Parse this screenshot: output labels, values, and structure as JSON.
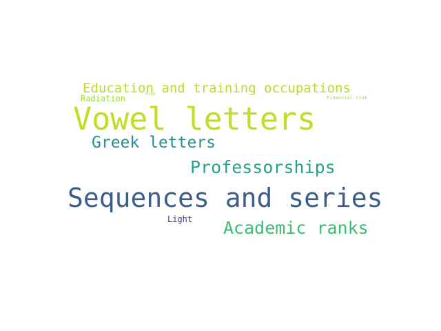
{
  "words": [
    {
      "text": "Education and training occupations",
      "color": "#b5de2b"
    },
    {
      "text": "Radiation",
      "color": "#a0da39"
    },
    {
      "text": "Risk",
      "color": "#a0da39"
    },
    {
      "text": "Financial risk",
      "color": "#a0da39"
    },
    {
      "text": "Vowel letters",
      "color": "#bddf26"
    },
    {
      "text": "Greek letters",
      "color": "#21918c"
    },
    {
      "text": "Professorships",
      "color": "#25a18e"
    },
    {
      "text": "Sequences and series",
      "color": "#3b5f8a"
    },
    {
      "text": "Light",
      "color": "#46327e"
    },
    {
      "text": "Academic ranks",
      "color": "#3dbc74"
    }
  ]
}
